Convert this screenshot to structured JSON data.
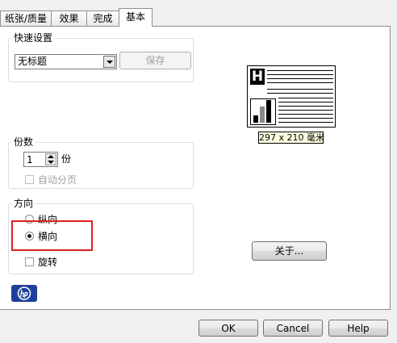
{
  "tabs": [
    {
      "label": "纸张/质量"
    },
    {
      "label": "效果"
    },
    {
      "label": "完成"
    },
    {
      "label": "基本"
    }
  ],
  "quick_settings": {
    "legend": "快速设置",
    "select_value": "无标题",
    "save_label": "保存"
  },
  "preview": {
    "logo_letter": "H",
    "size_label": "297 x 210 毫米"
  },
  "copies": {
    "legend": "份数",
    "value": "1",
    "unit": "份",
    "collate_label": "自动分页"
  },
  "orientation": {
    "legend": "方向",
    "portrait_label": "纵向",
    "landscape_label": "横向",
    "rotate_label": "旋转",
    "selected": "landscape"
  },
  "about_label": "关于...",
  "brand": {
    "logo": "hp"
  },
  "footer": {
    "ok_label": "OK",
    "cancel_label": "Cancel",
    "help_label": "Help"
  },
  "colors": {
    "highlight_box": "#e02020",
    "hp_blue": "#1d3f9c"
  }
}
